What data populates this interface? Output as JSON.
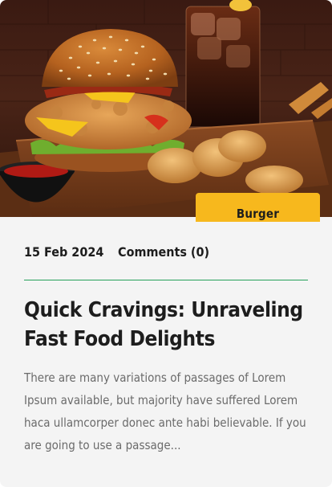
{
  "post": {
    "category": "Burger",
    "date": "15 Feb 2024",
    "comments_label": "Comments (0)",
    "title": "Quick Cravings: Unraveling Fast Food Delights",
    "excerpt": "There are many variations of passages of Lorem Ipsum available, but majority have suffered Lorem haca ullamcorper donec ante habi believable. If you are going to use a passage..."
  },
  "colors": {
    "accent_tag": "#f7b81d",
    "divider": "#25a05a",
    "card_bg": "#f4f4f4",
    "heading": "#1d1d1d",
    "body_text": "#6b6b6b"
  }
}
